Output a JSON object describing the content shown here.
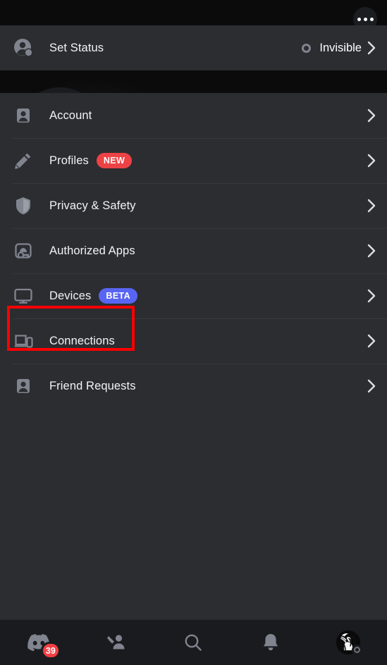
{
  "app": "Discord",
  "screen_title": "User Settings",
  "header": {
    "overflow_button_label": "More options",
    "username_redacted": true,
    "avatar_name": "user-avatar",
    "status": "invisible"
  },
  "status_row": {
    "icon": "set-status-icon",
    "label": "Set Status",
    "value": "Invisible",
    "value_indicator": "invisible-status-dot"
  },
  "settings_items": [
    {
      "id": "account",
      "label": "Account",
      "icon": "account-person-card-icon",
      "badge": null,
      "badge_color": null,
      "highlighted": true
    },
    {
      "id": "profiles",
      "label": "Profiles",
      "icon": "pencil-icon",
      "badge": "NEW",
      "badge_color": "#ed4245",
      "highlighted": false
    },
    {
      "id": "privacy-safety",
      "label": "Privacy & Safety",
      "icon": "shield-icon",
      "badge": null,
      "badge_color": null,
      "highlighted": false
    },
    {
      "id": "authorized-apps",
      "label": "Authorized Apps",
      "icon": "authorized-apps-icon",
      "badge": null,
      "badge_color": null,
      "highlighted": false
    },
    {
      "id": "devices",
      "label": "Devices",
      "icon": "monitor-icon",
      "badge": "BETA",
      "badge_color": "#5865f2",
      "highlighted": false
    },
    {
      "id": "connections",
      "label": "Connections",
      "icon": "laptop-phone-icon",
      "badge": null,
      "badge_color": null,
      "highlighted": false
    },
    {
      "id": "friend-requests",
      "label": "Friend Requests",
      "icon": "friend-requests-icon",
      "badge": null,
      "badge_color": null,
      "highlighted": false
    }
  ],
  "bottom_nav": [
    {
      "id": "servers",
      "icon": "discord-logo-icon",
      "badge": "39",
      "active": false
    },
    {
      "id": "friends",
      "icon": "friends-icon",
      "badge": null,
      "active": false
    },
    {
      "id": "search",
      "icon": "search-icon",
      "badge": null,
      "active": false
    },
    {
      "id": "notifications",
      "icon": "bell-icon",
      "badge": null,
      "active": false
    },
    {
      "id": "you",
      "icon": "user-avatar-icon",
      "badge": null,
      "active": true
    }
  ],
  "colors": {
    "row_background": "#2b2d31",
    "spacer_background": "#32353b",
    "banner_top": "#0a0a0b",
    "nav_background": "#1a1b1e",
    "badge_red": "#ed4245",
    "badge_blurple": "#5865f2",
    "annotation_red": "#ff0000",
    "text_primary": "#f2f3f5",
    "icon_gray": "#80848e"
  }
}
